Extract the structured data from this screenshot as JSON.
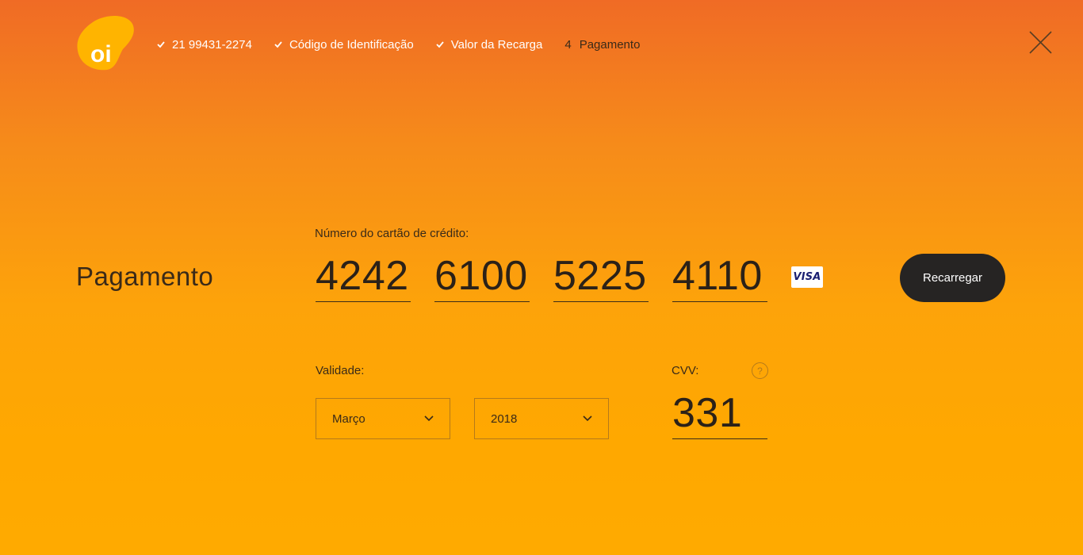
{
  "brand": {
    "logo_text": "oi",
    "logo_color": "#ffb400"
  },
  "steps": [
    {
      "label": "21 99431-2274",
      "done": true
    },
    {
      "label": "Código de Identificação",
      "done": true
    },
    {
      "label": "Valor da Recarga",
      "done": true
    },
    {
      "number": "4",
      "label": "Pagamento",
      "done": false
    }
  ],
  "close_icon": "close-icon",
  "section_title": "Pagamento",
  "card": {
    "label": "Número do cartão de crédito:",
    "groups": [
      "4242",
      "6100",
      "5225",
      "4110"
    ],
    "brand_badge": "VISA"
  },
  "recharge_button": "Recarregar",
  "expiry": {
    "label": "Validade:",
    "month": "Março",
    "year": "2018"
  },
  "cvv": {
    "label": "CVV:",
    "value": "331",
    "help": "?"
  },
  "colors": {
    "gradient_top": "#f06b25",
    "gradient_bottom": "#ffaa00",
    "button_bg": "#262423",
    "text_dark": "#3a2a18"
  }
}
